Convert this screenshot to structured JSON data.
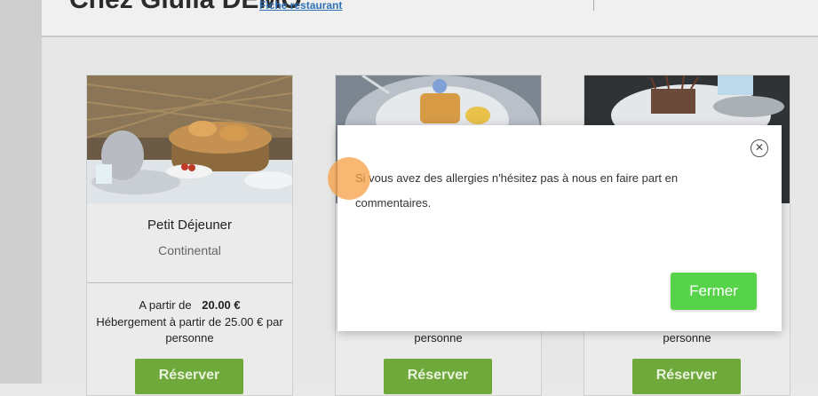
{
  "header": {
    "restaurant_name": "Chez Giulia DEMO",
    "fiche_link": "Fiche restaurant"
  },
  "cards": [
    {
      "title": "Petit Déjeuner",
      "subtitle": "Continental",
      "price_prefix": "A partir de",
      "price_value": "20.00 €",
      "hosting": "Hébergement à partir de 25.00 € par personne",
      "reserve_label": "Réserver"
    },
    {
      "hosting_tail": "personne",
      "reserve_label": "Réserver"
    },
    {
      "hosting_tail": "personne",
      "reserve_label": "Réserver"
    }
  ],
  "modal": {
    "message": "Si vous avez des allergies n'hésitez pas à nous en faire part en commentaires.",
    "close_icon": "close-icon",
    "fermer_label": "Fermer"
  },
  "colors": {
    "reserve_button": "#6fa83b",
    "fermer_button": "#57d34a",
    "link": "#2e6fb5"
  }
}
